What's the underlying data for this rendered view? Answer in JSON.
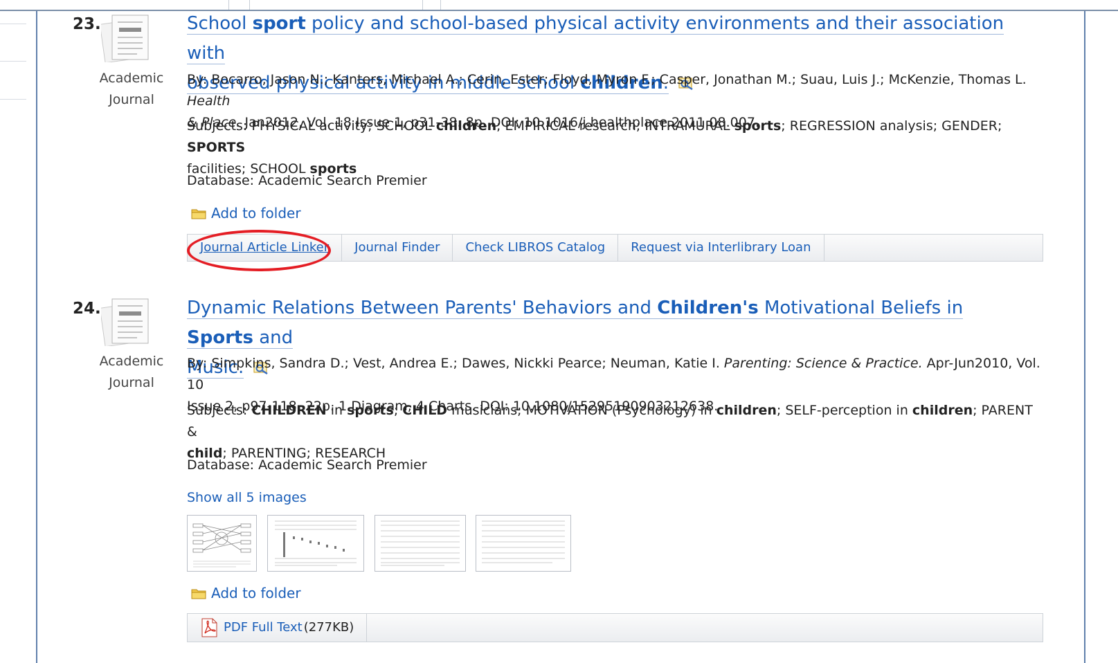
{
  "results": [
    {
      "number": "23.",
      "doc_type_line1": "Academic",
      "doc_type_line2": "Journal",
      "title_line1": [
        {
          "text": "School ",
          "bold": false
        },
        {
          "text": "sport",
          "bold": true
        },
        {
          "text": " policy and school-based physical activity environments and their association with",
          "bold": false
        }
      ],
      "title_line2": [
        {
          "text": "observed physical activity in middle school ",
          "bold": false
        },
        {
          "text": "children",
          "bold": true
        },
        {
          "text": ".",
          "bold": false
        }
      ],
      "byline1_prefix": "By: Bocarro, Jason N.; Kanters, Michael A.; Cerin, Ester; Floyd, Myron F.; Casper, Jonathan M.; Suau, Luis J.; McKenzie, Thomas L. ",
      "byline1_source": "Health",
      "byline2_source": "& Place.",
      "byline2_rest": " Jan2012, Vol. 18 Issue 1, p31-38. 8p. DOI: 10.1016/j.healthplace.2011.08.007.",
      "subjects_line1": [
        {
          "text": "Subjects: PHYSICAL activity; SCHOOL ",
          "bold": false
        },
        {
          "text": "children",
          "bold": true
        },
        {
          "text": "; EMPIRICAL research; INTRAMURAL ",
          "bold": false
        },
        {
          "text": "sports",
          "bold": true
        },
        {
          "text": "; REGRESSION analysis; GENDER; ",
          "bold": false
        },
        {
          "text": "SPORTS",
          "bold": true
        }
      ],
      "subjects_line2": [
        {
          "text": "facilities; SCHOOL ",
          "bold": false
        },
        {
          "text": "sports",
          "bold": true
        }
      ],
      "database": "Database: Academic Search Premier",
      "add_to_folder": "Add to folder",
      "links": [
        "Journal Article Linker",
        "Journal Finder",
        "Check LIBROS Catalog",
        "Request via Interlibrary Loan"
      ]
    },
    {
      "number": "24.",
      "doc_type_line1": "Academic",
      "doc_type_line2": "Journal",
      "title_line1": [
        {
          "text": "Dynamic Relations Between Parents' Behaviors and ",
          "bold": false
        },
        {
          "text": "Children's",
          "bold": true
        },
        {
          "text": " Motivational Beliefs in ",
          "bold": false
        },
        {
          "text": "Sports",
          "bold": true
        },
        {
          "text": " and",
          "bold": false
        }
      ],
      "title_line2": [
        {
          "text": "Music.",
          "bold": false
        }
      ],
      "byline1_prefix": "By: Simpkins, Sandra D.; Vest, Andrea E.; Dawes, Nickki Pearce; Neuman, Katie I. ",
      "byline1_source": "Parenting: Science & Practice.",
      "byline1_rest": " Apr-Jun2010, Vol. 10",
      "byline2_rest": "Issue 2, p97-118. 22p. 1 Diagram, 4 Charts. DOI: 10.1080/15295190903212638.",
      "subjects_line1": [
        {
          "text": "Subjects: ",
          "bold": false
        },
        {
          "text": "CHILDREN",
          "bold": true
        },
        {
          "text": " in ",
          "bold": false
        },
        {
          "text": "sports",
          "bold": true
        },
        {
          "text": "; ",
          "bold": false
        },
        {
          "text": "CHILD",
          "bold": true
        },
        {
          "text": " musicians; MOTIVATION (Psychology) in ",
          "bold": false
        },
        {
          "text": "children",
          "bold": true
        },
        {
          "text": "; SELF-perception in ",
          "bold": false
        },
        {
          "text": "children",
          "bold": true
        },
        {
          "text": "; PARENT &",
          "bold": false
        }
      ],
      "subjects_line2": [
        {
          "text": "child",
          "bold": true
        },
        {
          "text": "; PARENTING; RESEARCH",
          "bold": false
        }
      ],
      "database": "Database: Academic Search Premier",
      "show_images": "Show all 5 images",
      "add_to_folder": "Add to folder",
      "pdf_label": "PDF Full Text",
      "pdf_size": "(277KB)"
    }
  ],
  "colors": {
    "link": "#1a5eb8",
    "highlight_circle": "#e41d24",
    "frame": "#5f7fab"
  }
}
